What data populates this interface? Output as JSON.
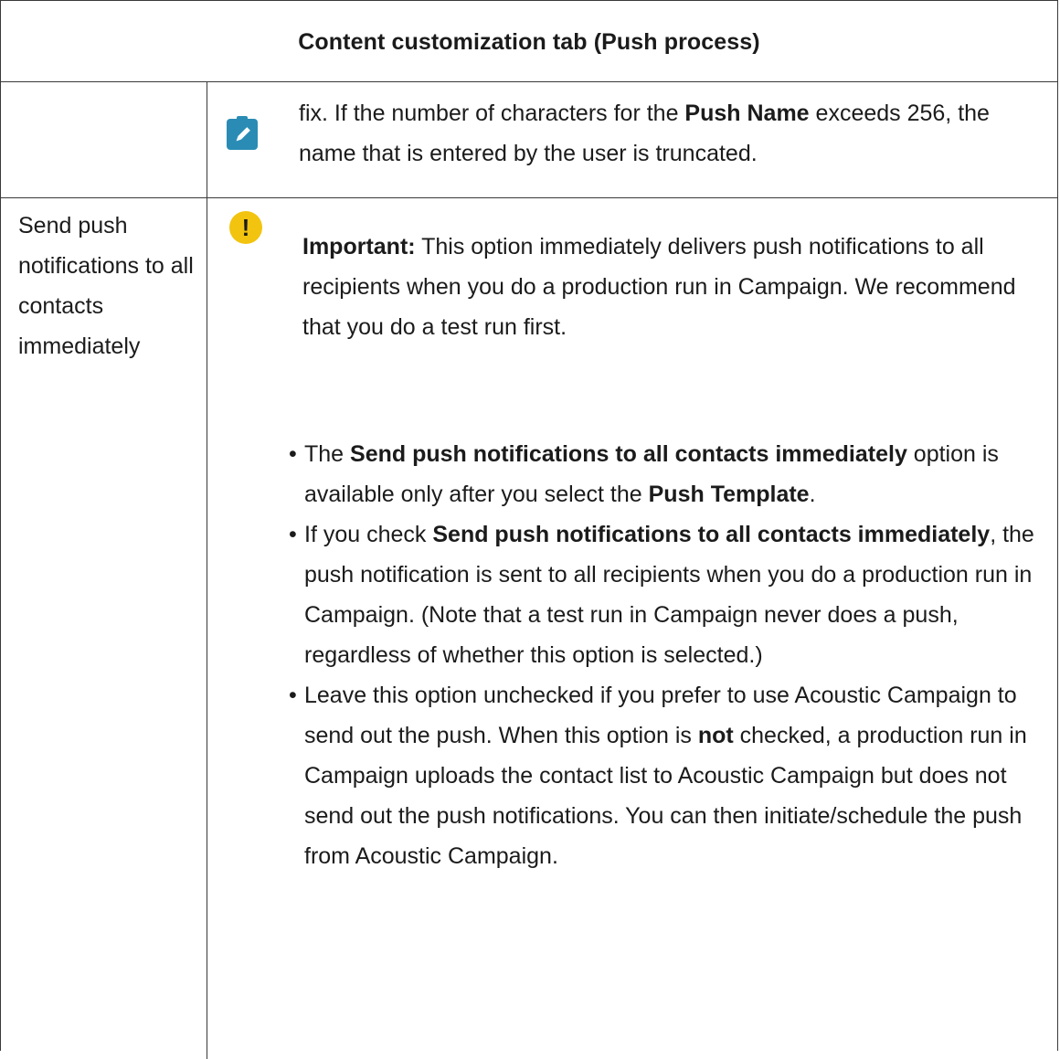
{
  "table": {
    "header": "Content customization tab (Push process)",
    "row1": {
      "note_text_1": "fix. If the number of characters for the ",
      "note_bold_1": "Push Name",
      "note_text_2": " exceeds 256, the name that is entered by the user is truncated."
    },
    "row2": {
      "label": "Send push notifications to all contacts immediately",
      "important": {
        "label": "Important:",
        "text": " This option immediately delivers push notifications to all recipients when you do a production run in Campaign. We recommend that you do a test run first."
      },
      "bullets": [
        {
          "t1": "The ",
          "b1": "Send push notifications to all contacts immediately",
          "t2": " option is available only after you select the ",
          "b2": "Push Template",
          "t3": "."
        },
        {
          "t1": "If you check ",
          "b1": "Send push notifications to all contacts immediately",
          "t2": ", the push notification is sent to all recipients when you do a production run in Campaign. (Note that a test run in Campaign never does a push, regardless of whether this option is selected.)"
        },
        {
          "t1": "Leave this option unchecked if you prefer to use Acoustic Campaign to send out the push. When this option is ",
          "b1": "not",
          "t2": " checked, a production run in Campaign uploads the contact list to Acoustic Campaign but does not send out the push notifications. You can then initiate/schedule the push from Acoustic Campaign."
        }
      ]
    }
  }
}
